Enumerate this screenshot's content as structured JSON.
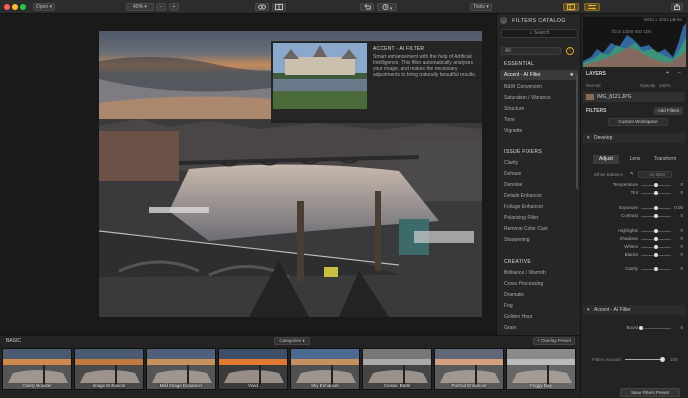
{
  "toolbar": {
    "open_label": "Open",
    "zoom_value": "40%",
    "tools_label": "Tools",
    "share_label": "Share"
  },
  "tooltip": {
    "title": "ACCENT - AI FILTER",
    "description": "Smart enhancement with the help of Artificial Intelligence. This filter automatically analyzes your image, and makes the necessary adjustments to bring naturally beautiful results."
  },
  "catalog": {
    "header": "FILTERS CATALOG",
    "search_label": "Search",
    "select_value": "All",
    "sections": [
      {
        "title": "ESSENTIAL",
        "items": [
          "Accent - AI Filter",
          "B&W Conversion",
          "Saturation / Vibrance",
          "Structure",
          "Tone",
          "Vignette"
        ]
      },
      {
        "title": "ISSUE FIXERS",
        "items": [
          "Clarity",
          "Dehaze",
          "Denoise",
          "Details Enhancer",
          "Foliage Enhancer",
          "Polarizing Filter",
          "Remove Color Cast",
          "Sharpening"
        ]
      },
      {
        "title": "CREATIVE",
        "items": [
          "Brilliance / Warmth",
          "Cross Processing",
          "Dramatic",
          "Fog",
          "Golden Hour",
          "Grain"
        ]
      }
    ]
  },
  "panel": {
    "image_info": "6032 x 3024 px",
    "bit_depth": "8-bit",
    "exif": "f/2.8   1/250   ISO 100",
    "layers_title": "LAYERS",
    "layer_name": "Normal",
    "layer_opacity": "Opacity",
    "opacity_value": "100%",
    "image_file": "IMG_8121.JPG",
    "filters_title": "FILTERS",
    "add_filters": "Add Filters",
    "workspace": "Custom Workspace",
    "develop_label": "Develop",
    "tabs": [
      "Adjust",
      "Lens",
      "Transform"
    ],
    "white_balance_label": "White Balance",
    "white_balance_value": "As Shot",
    "sliders": [
      {
        "label": "Temperature",
        "value": "0",
        "pos": 0.5
      },
      {
        "label": "Tint",
        "value": "0",
        "pos": 0.5
      },
      {
        "label": "Exposure",
        "value": "0.00",
        "pos": 0.5
      },
      {
        "label": "Contrast",
        "value": "0",
        "pos": 0.5
      },
      {
        "label": "Highlights",
        "value": "0",
        "pos": 0.5
      },
      {
        "label": "Shadows",
        "value": "0",
        "pos": 0.5
      },
      {
        "label": "Whites",
        "value": "0",
        "pos": 0.5
      },
      {
        "label": "Blacks",
        "value": "0",
        "pos": 0.5
      },
      {
        "label": "Clarity",
        "value": "0",
        "pos": 0.5
      }
    ],
    "accent_label": "Accent - AI Filter",
    "boost_label": "Boost",
    "boost_value": "0",
    "filters_amount_label": "Filters Amount",
    "filters_amount_value": "100",
    "save_preset": "Save Filters Preset"
  },
  "strip": {
    "category": "BASIC",
    "categories_label": "Categories",
    "overlay_preset": "Overlay Preset",
    "presets": [
      "Clarity Booster",
      "Image Enhancer",
      "Mild Image Enhancer",
      "Vivid",
      "Sky Enhancer",
      "Classic B&W",
      "Portrait Enhancer",
      "Foggy Day"
    ]
  }
}
